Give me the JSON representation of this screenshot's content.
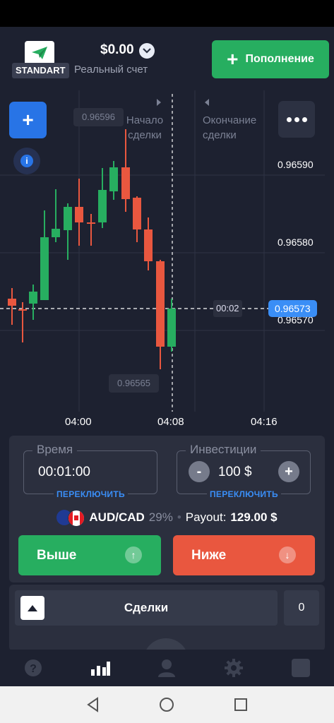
{
  "header": {
    "account_type": "STANDART",
    "balance": "$0.00",
    "account_name": "Реальный счет",
    "deposit_label": "Пополнение"
  },
  "chart": {
    "start_label": "Начало сделки",
    "end_label": "Окончание сделки",
    "price_labels": [
      "0.96590",
      "0.96580",
      "0.96570"
    ],
    "current_price": "0.96573",
    "countdown": "00:02",
    "high_tag": "0.96596",
    "low_tag": "0.96565",
    "time_ticks": [
      "04:00",
      "04:08",
      "04:16"
    ],
    "colors": {
      "up": "#27ae60",
      "down": "#e9573f",
      "accent": "#3a8ef6"
    }
  },
  "trade": {
    "time_legend": "Время",
    "time_value": "00:01:00",
    "switch_label": "ПЕРЕКЛЮЧИТЬ",
    "invest_legend": "Инвестиции",
    "invest_value": "100 $",
    "asset": "AUD/CAD",
    "asset_percent": "29%",
    "payout_label": "Payout:",
    "payout_value": "129.00 $",
    "higher_label": "Выше",
    "lower_label": "Ниже"
  },
  "deals": {
    "label": "Сделки",
    "count": "0"
  },
  "nav": {
    "icons": [
      "help-icon",
      "chart-icon",
      "user-icon",
      "settings-icon",
      "square-icon"
    ]
  }
}
